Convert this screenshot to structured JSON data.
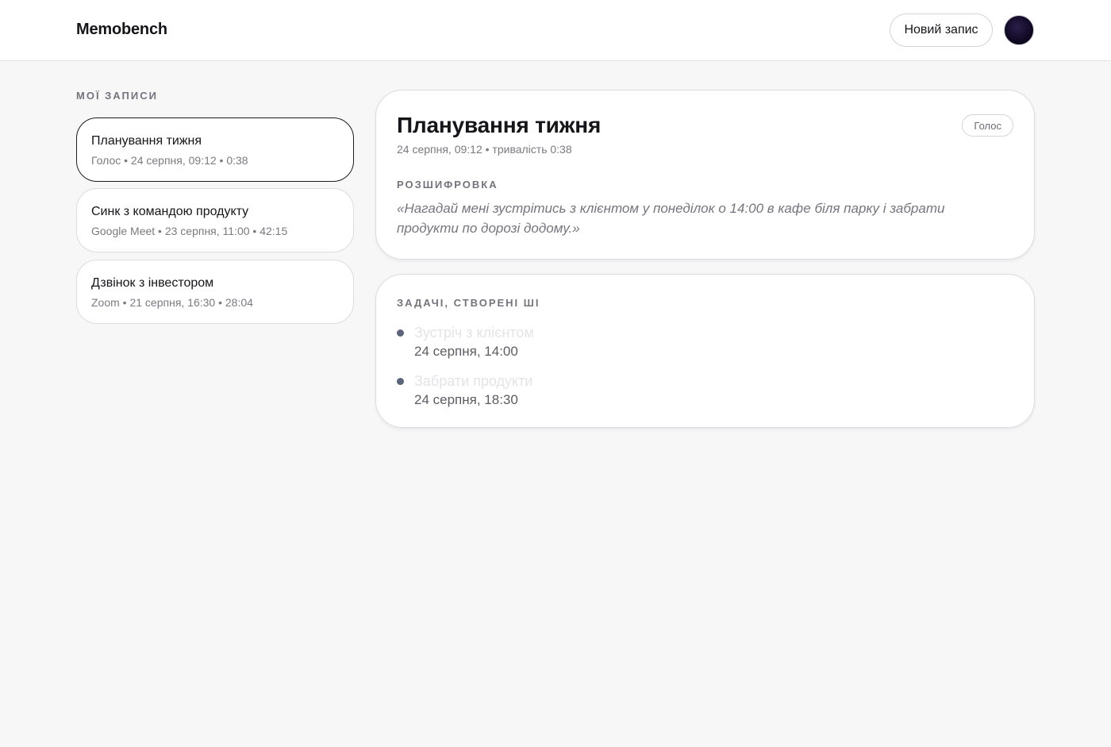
{
  "app": {
    "title": "Memobench"
  },
  "header": {
    "new_record_label": "Новий запис"
  },
  "sidebar": {
    "label": "МОЇ ЗАПИСИ",
    "records": [
      {
        "title": "Планування тижня",
        "meta": "Голос • 24 серпня, 09:12 • 0:38",
        "active": true
      },
      {
        "title": "Синк з командою продукту",
        "meta": "Google Meet • 23 серпня, 11:00 • 42:15",
        "active": false
      },
      {
        "title": "Дзвінок з інвестором",
        "meta": "Zoom • 21 серпня, 16:30 • 28:04",
        "active": false
      }
    ]
  },
  "detail": {
    "title": "Планування тижня",
    "meta": "24 серпня, 09:12 • тривалість 0:38",
    "badge": "Голос",
    "transcript_label": "РОЗШИФРОВКА",
    "transcript": "«Нагадай мені зустрітись з клієнтом у понеділок о 14:00 в кафе біля парку і забрати продукти по дорозі додому.»"
  },
  "tasks": {
    "label": "ЗАДАЧІ, СТВОРЕНІ ШІ",
    "items": [
      {
        "title": "Зустріч з клієнтом",
        "time": "24 серпня, 14:00"
      },
      {
        "title": "Забрати продукти",
        "time": "24 серпня, 18:30"
      }
    ]
  },
  "colors": {
    "background": "#f7f7f8",
    "surface": "#ffffff",
    "active_border": "#1b1b20",
    "task_dot": "#5b6478"
  }
}
